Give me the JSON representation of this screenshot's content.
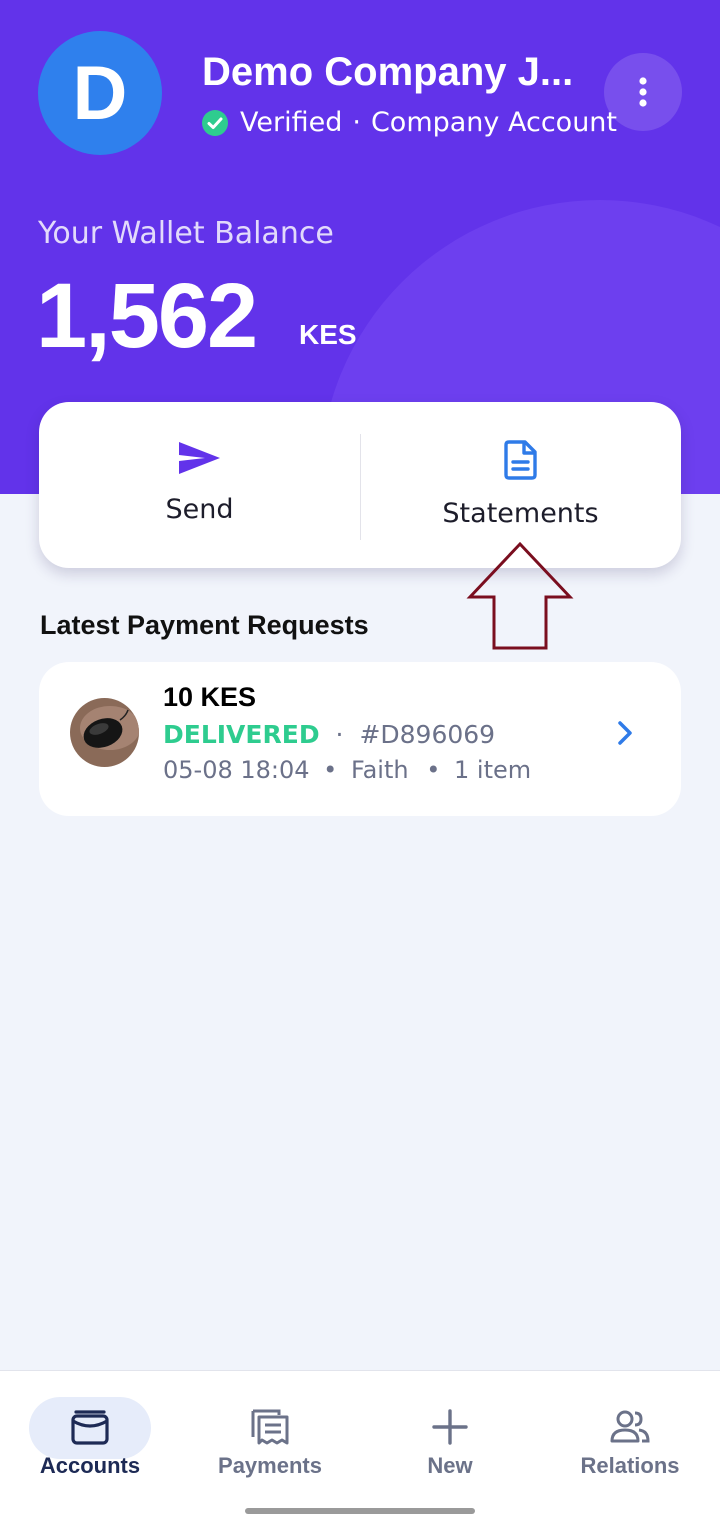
{
  "header": {
    "avatar_letter": "D",
    "company_name": "Demo Company J...",
    "verified_label": "Verified",
    "separator": "·",
    "account_type": "Company Account",
    "colors": {
      "primary": "#6233EA",
      "avatar": "#2F80ED",
      "verified": "#2ECC8F"
    }
  },
  "wallet": {
    "label": "Your Wallet Balance",
    "amount": "1,562",
    "currency": "KES"
  },
  "actions": {
    "send_label": "Send",
    "statements_label": "Statements"
  },
  "payment_requests": {
    "title": "Latest Payment Requests",
    "items": [
      {
        "amount": "10 KES",
        "status": "DELIVERED",
        "separator": "·",
        "order_id": "#D896069",
        "date_time": "05-08 18:04",
        "bullet1": "•",
        "recipient": "Faith",
        "bullet2": "•",
        "item_count": "1 item"
      }
    ]
  },
  "bottom_nav": {
    "items": [
      {
        "label": "Accounts",
        "icon": "wallet-icon",
        "active": true
      },
      {
        "label": "Payments",
        "icon": "receipt-icon",
        "active": false
      },
      {
        "label": "New",
        "icon": "plus-icon",
        "active": false
      },
      {
        "label": "Relations",
        "icon": "people-icon",
        "active": false
      }
    ]
  }
}
